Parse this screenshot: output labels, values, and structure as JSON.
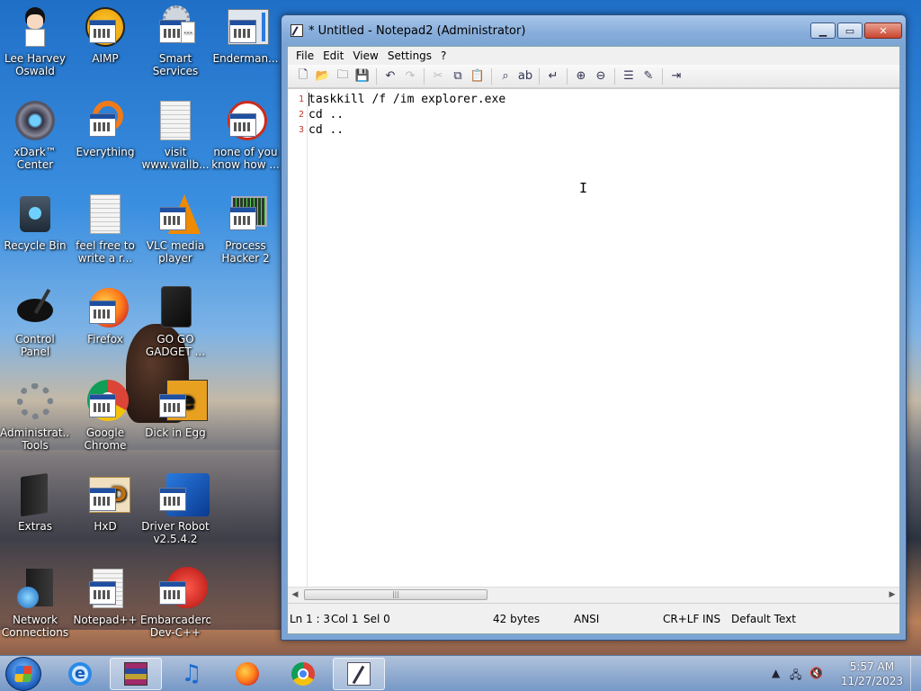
{
  "desktop": {
    "icons": [
      {
        "label": "Lee Harvey Oswald",
        "icon": "doll-icon"
      },
      {
        "label": "AIMP",
        "icon": "aimp-icon"
      },
      {
        "label": "Smart Services",
        "icon": "gears-icon"
      },
      {
        "label": "Enderman...",
        "icon": "app-window-icon"
      },
      {
        "label": "xDark™ Center",
        "icon": "xdark-icon"
      },
      {
        "label": "Everything",
        "icon": "everything-icon"
      },
      {
        "label": "visit www.wallb...",
        "icon": "text-document-icon"
      },
      {
        "label": "none of you know how ...",
        "icon": "app-window-icon"
      },
      {
        "label": "Recycle Bin",
        "icon": "recycle-bin-icon"
      },
      {
        "label": "feel free to write a r...",
        "icon": "text-document-icon"
      },
      {
        "label": "VLC media player",
        "icon": "vlc-icon"
      },
      {
        "label": "Process Hacker 2",
        "icon": "process-hacker-icon"
      },
      {
        "label": "Control Panel",
        "icon": "control-panel-icon"
      },
      {
        "label": "Firefox",
        "icon": "firefox-icon"
      },
      {
        "label": "GO GO GADGET ...",
        "icon": "gadget-icon"
      },
      {
        "label": "Administrat... Tools",
        "icon": "admin-tools-icon"
      },
      {
        "label": "Google Chrome",
        "icon": "chrome-icon"
      },
      {
        "label": "Dick in Egg",
        "icon": "egg-icon"
      },
      {
        "label": "Extras",
        "icon": "folder-icon"
      },
      {
        "label": "HxD",
        "icon": "hxd-icon"
      },
      {
        "label": "Driver Robot v2.5.4.2",
        "icon": "driver-robot-icon"
      },
      {
        "label": "Network Connections",
        "icon": "network-icon"
      },
      {
        "label": "Notepad++",
        "icon": "notepadpp-icon"
      },
      {
        "label": "Embarcadero Dev-C++",
        "icon": "devcpp-icon"
      }
    ]
  },
  "window": {
    "title": "* Untitled - Notepad2 (Administrator)",
    "menu": [
      "File",
      "Edit",
      "View",
      "Settings",
      "?"
    ],
    "editor": {
      "line_numbers": [
        "1",
        "2",
        "3"
      ],
      "lines": [
        "taskkill /f /im explorer.exe",
        "cd ..",
        "cd .."
      ],
      "cursor_glyph": "I"
    },
    "status": {
      "position": "Ln 1 : 3",
      "column": "Col 1",
      "selection": "Sel 0",
      "size": "42 bytes",
      "encoding": "ANSI",
      "eol": "CR+LF",
      "mode": "INS",
      "scheme": "Default Text"
    }
  },
  "taskbar": {
    "items": [
      "internet-explorer-icon",
      "winrar-icon",
      "music-icon",
      "firefox-icon",
      "chrome-icon",
      "notepad2-icon"
    ],
    "clock": {
      "time": "5:57 AM",
      "date": "11/27/2023"
    }
  },
  "colors": {
    "line_number": "#c0392b",
    "close_button": "#c8452e"
  }
}
